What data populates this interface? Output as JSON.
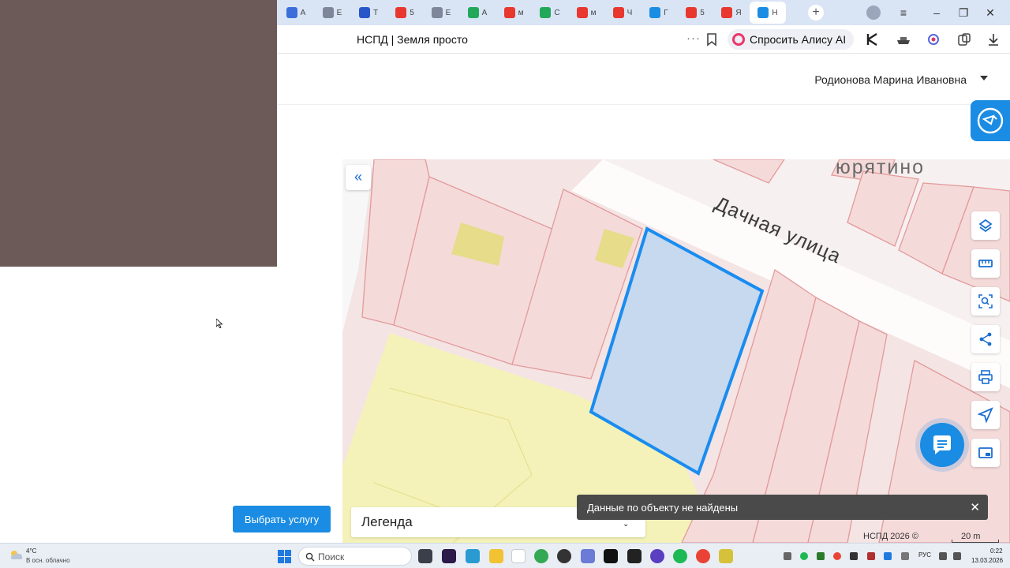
{
  "browser": {
    "tabs": [
      {
        "label": "А",
        "color": "#3b6ed8"
      },
      {
        "label": "Е",
        "color": "#7e8799"
      },
      {
        "label": "Т",
        "color": "#2856c9"
      },
      {
        "label": "5",
        "color": "#e8372f"
      },
      {
        "label": "Е",
        "color": "#7e8799"
      },
      {
        "label": "А",
        "color": "#23a85a"
      },
      {
        "label": "м",
        "color": "#e8372f"
      },
      {
        "label": "С",
        "color": "#23a85a"
      },
      {
        "label": "м",
        "color": "#e8372f"
      },
      {
        "label": "Ч",
        "color": "#e8372f"
      },
      {
        "label": "Г",
        "color": "#1b8ce3"
      },
      {
        "label": "5",
        "color": "#e8372f"
      },
      {
        "label": "Я",
        "color": "#e8372f"
      },
      {
        "label": "Н",
        "color": "#1b8ce3",
        "active": true
      }
    ],
    "new_tab_label": "+",
    "page_title": "НСПД | Земля просто",
    "more_label": "···",
    "alice_label": "Спросить Алису AI"
  },
  "header": {
    "user_name": "Родионова Марина Ивановна"
  },
  "left_panel": {
    "select_service_label": "Выбрать услугу"
  },
  "map": {
    "collapse_label": "«",
    "street_label": "Дачная улица",
    "village_label": "юрятино",
    "legend_label": "Легенда",
    "toast_text": "Данные по объекту не найдены",
    "toast_close": "✕",
    "copyright": "НСПД 2026 ©",
    "scale_label": "20 m",
    "selected_parcel_color": "#1a8cf0"
  },
  "taskbar": {
    "weather_temp": "4°C",
    "weather_desc": "В осн. облачно",
    "search_placeholder": "Поиск",
    "lang": "РУС",
    "time": "0:22",
    "date": "13.03.2026"
  }
}
